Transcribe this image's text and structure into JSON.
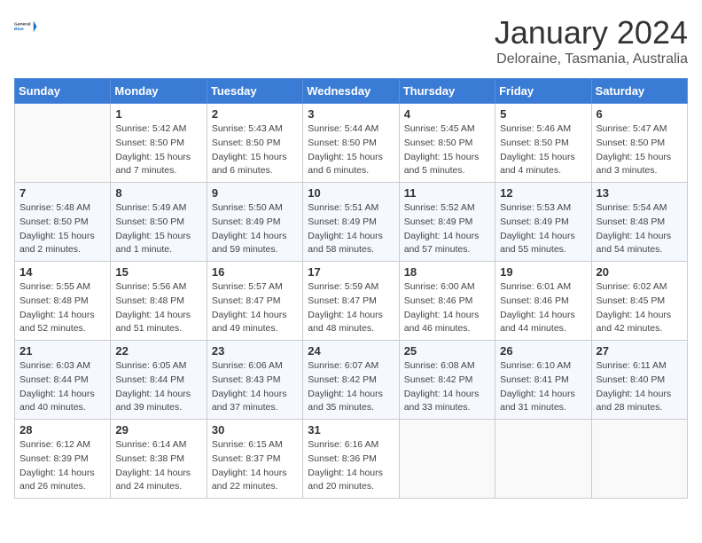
{
  "logo": {
    "text_general": "General",
    "text_blue": "Blue"
  },
  "header": {
    "month": "January 2024",
    "location": "Deloraine, Tasmania, Australia"
  },
  "weekdays": [
    "Sunday",
    "Monday",
    "Tuesday",
    "Wednesday",
    "Thursday",
    "Friday",
    "Saturday"
  ],
  "weeks": [
    [
      {
        "day": "",
        "empty": true
      },
      {
        "day": "1",
        "sunrise": "Sunrise: 5:42 AM",
        "sunset": "Sunset: 8:50 PM",
        "daylight": "Daylight: 15 hours and 7 minutes."
      },
      {
        "day": "2",
        "sunrise": "Sunrise: 5:43 AM",
        "sunset": "Sunset: 8:50 PM",
        "daylight": "Daylight: 15 hours and 6 minutes."
      },
      {
        "day": "3",
        "sunrise": "Sunrise: 5:44 AM",
        "sunset": "Sunset: 8:50 PM",
        "daylight": "Daylight: 15 hours and 6 minutes."
      },
      {
        "day": "4",
        "sunrise": "Sunrise: 5:45 AM",
        "sunset": "Sunset: 8:50 PM",
        "daylight": "Daylight: 15 hours and 5 minutes."
      },
      {
        "day": "5",
        "sunrise": "Sunrise: 5:46 AM",
        "sunset": "Sunset: 8:50 PM",
        "daylight": "Daylight: 15 hours and 4 minutes."
      },
      {
        "day": "6",
        "sunrise": "Sunrise: 5:47 AM",
        "sunset": "Sunset: 8:50 PM",
        "daylight": "Daylight: 15 hours and 3 minutes."
      }
    ],
    [
      {
        "day": "7",
        "sunrise": "Sunrise: 5:48 AM",
        "sunset": "Sunset: 8:50 PM",
        "daylight": "Daylight: 15 hours and 2 minutes."
      },
      {
        "day": "8",
        "sunrise": "Sunrise: 5:49 AM",
        "sunset": "Sunset: 8:50 PM",
        "daylight": "Daylight: 15 hours and 1 minute."
      },
      {
        "day": "9",
        "sunrise": "Sunrise: 5:50 AM",
        "sunset": "Sunset: 8:49 PM",
        "daylight": "Daylight: 14 hours and 59 minutes."
      },
      {
        "day": "10",
        "sunrise": "Sunrise: 5:51 AM",
        "sunset": "Sunset: 8:49 PM",
        "daylight": "Daylight: 14 hours and 58 minutes."
      },
      {
        "day": "11",
        "sunrise": "Sunrise: 5:52 AM",
        "sunset": "Sunset: 8:49 PM",
        "daylight": "Daylight: 14 hours and 57 minutes."
      },
      {
        "day": "12",
        "sunrise": "Sunrise: 5:53 AM",
        "sunset": "Sunset: 8:49 PM",
        "daylight": "Daylight: 14 hours and 55 minutes."
      },
      {
        "day": "13",
        "sunrise": "Sunrise: 5:54 AM",
        "sunset": "Sunset: 8:48 PM",
        "daylight": "Daylight: 14 hours and 54 minutes."
      }
    ],
    [
      {
        "day": "14",
        "sunrise": "Sunrise: 5:55 AM",
        "sunset": "Sunset: 8:48 PM",
        "daylight": "Daylight: 14 hours and 52 minutes."
      },
      {
        "day": "15",
        "sunrise": "Sunrise: 5:56 AM",
        "sunset": "Sunset: 8:48 PM",
        "daylight": "Daylight: 14 hours and 51 minutes."
      },
      {
        "day": "16",
        "sunrise": "Sunrise: 5:57 AM",
        "sunset": "Sunset: 8:47 PM",
        "daylight": "Daylight: 14 hours and 49 minutes."
      },
      {
        "day": "17",
        "sunrise": "Sunrise: 5:59 AM",
        "sunset": "Sunset: 8:47 PM",
        "daylight": "Daylight: 14 hours and 48 minutes."
      },
      {
        "day": "18",
        "sunrise": "Sunrise: 6:00 AM",
        "sunset": "Sunset: 8:46 PM",
        "daylight": "Daylight: 14 hours and 46 minutes."
      },
      {
        "day": "19",
        "sunrise": "Sunrise: 6:01 AM",
        "sunset": "Sunset: 8:46 PM",
        "daylight": "Daylight: 14 hours and 44 minutes."
      },
      {
        "day": "20",
        "sunrise": "Sunrise: 6:02 AM",
        "sunset": "Sunset: 8:45 PM",
        "daylight": "Daylight: 14 hours and 42 minutes."
      }
    ],
    [
      {
        "day": "21",
        "sunrise": "Sunrise: 6:03 AM",
        "sunset": "Sunset: 8:44 PM",
        "daylight": "Daylight: 14 hours and 40 minutes."
      },
      {
        "day": "22",
        "sunrise": "Sunrise: 6:05 AM",
        "sunset": "Sunset: 8:44 PM",
        "daylight": "Daylight: 14 hours and 39 minutes."
      },
      {
        "day": "23",
        "sunrise": "Sunrise: 6:06 AM",
        "sunset": "Sunset: 8:43 PM",
        "daylight": "Daylight: 14 hours and 37 minutes."
      },
      {
        "day": "24",
        "sunrise": "Sunrise: 6:07 AM",
        "sunset": "Sunset: 8:42 PM",
        "daylight": "Daylight: 14 hours and 35 minutes."
      },
      {
        "day": "25",
        "sunrise": "Sunrise: 6:08 AM",
        "sunset": "Sunset: 8:42 PM",
        "daylight": "Daylight: 14 hours and 33 minutes."
      },
      {
        "day": "26",
        "sunrise": "Sunrise: 6:10 AM",
        "sunset": "Sunset: 8:41 PM",
        "daylight": "Daylight: 14 hours and 31 minutes."
      },
      {
        "day": "27",
        "sunrise": "Sunrise: 6:11 AM",
        "sunset": "Sunset: 8:40 PM",
        "daylight": "Daylight: 14 hours and 28 minutes."
      }
    ],
    [
      {
        "day": "28",
        "sunrise": "Sunrise: 6:12 AM",
        "sunset": "Sunset: 8:39 PM",
        "daylight": "Daylight: 14 hours and 26 minutes."
      },
      {
        "day": "29",
        "sunrise": "Sunrise: 6:14 AM",
        "sunset": "Sunset: 8:38 PM",
        "daylight": "Daylight: 14 hours and 24 minutes."
      },
      {
        "day": "30",
        "sunrise": "Sunrise: 6:15 AM",
        "sunset": "Sunset: 8:37 PM",
        "daylight": "Daylight: 14 hours and 22 minutes."
      },
      {
        "day": "31",
        "sunrise": "Sunrise: 6:16 AM",
        "sunset": "Sunset: 8:36 PM",
        "daylight": "Daylight: 14 hours and 20 minutes."
      },
      {
        "day": "",
        "empty": true
      },
      {
        "day": "",
        "empty": true
      },
      {
        "day": "",
        "empty": true
      }
    ]
  ]
}
